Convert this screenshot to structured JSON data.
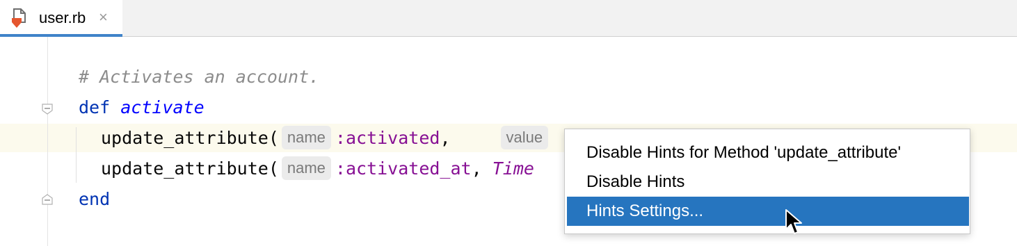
{
  "tab": {
    "file_name": "user.rb",
    "close_glyph": "×",
    "icon": "ruby-file-icon"
  },
  "editor": {
    "lines": [
      {
        "comment": "# Activates an account."
      },
      {
        "keyword": "def",
        "method": "activate"
      },
      {
        "call": "update_attribute(",
        "hint": "name",
        "arg": ":activated",
        "sep": ",",
        "hint2": "value"
      },
      {
        "call": "update_attribute(",
        "hint": "name",
        "arg": ":activated_at",
        "sep": ",",
        "const": "Time"
      },
      {
        "keyword": "end"
      }
    ]
  },
  "context_menu": {
    "items": [
      {
        "label": "Disable Hints for Method 'update_attribute'"
      },
      {
        "label": "Disable Hints"
      },
      {
        "label": "Hints Settings..."
      }
    ],
    "selected_index": 2
  },
  "colors": {
    "accent": "#4083c9",
    "selection": "#2675bf",
    "keyword": "#0033b3",
    "symbol": "#871094",
    "comment": "#8c8c8c",
    "current_line": "#fcfaed"
  }
}
